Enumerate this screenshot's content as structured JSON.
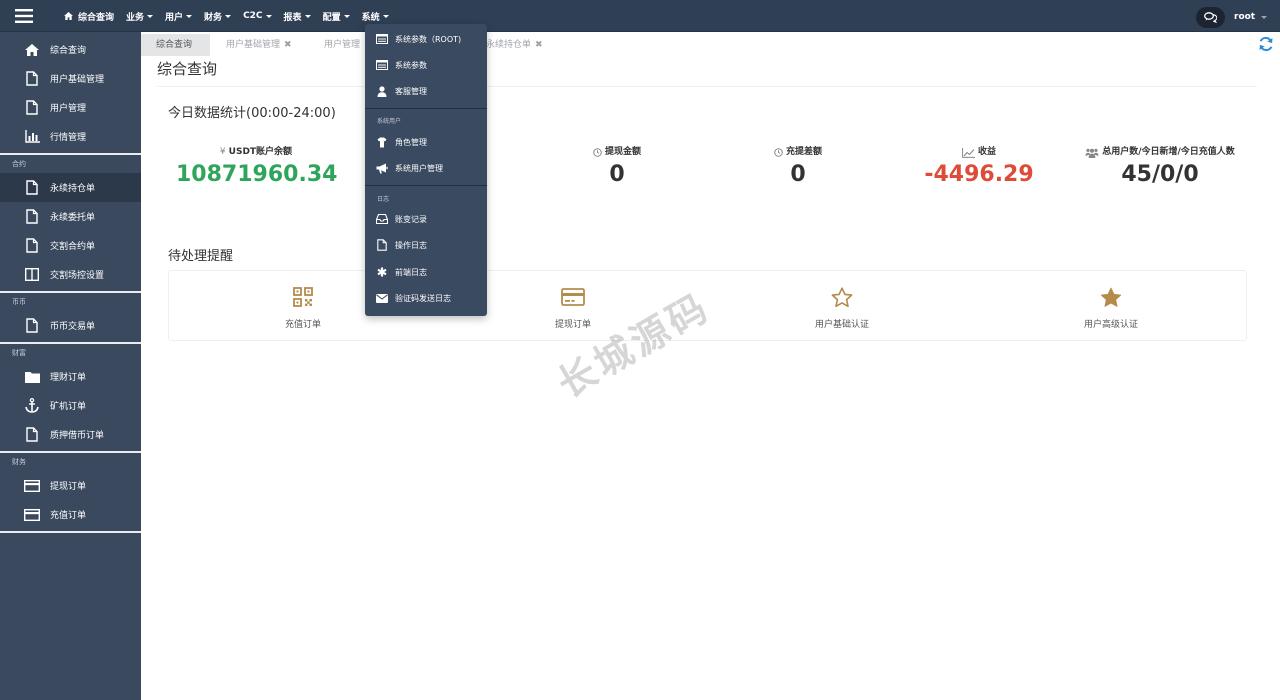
{
  "topbar": {
    "nav": [
      {
        "label": "综合查询",
        "icon": "home-icon",
        "has_caret": false
      },
      {
        "label": "业务",
        "has_caret": true
      },
      {
        "label": "用户",
        "has_caret": true
      },
      {
        "label": "财务",
        "has_caret": true
      },
      {
        "label": "C2C",
        "has_caret": true
      },
      {
        "label": "报表",
        "has_caret": true
      },
      {
        "label": "配置",
        "has_caret": true
      },
      {
        "label": "系统",
        "has_caret": true
      }
    ],
    "user": "root"
  },
  "sidebar": {
    "group0": {
      "items": [
        {
          "label": "综合查询",
          "icon": "home-icon"
        },
        {
          "label": "用户基础管理",
          "icon": "file-icon"
        },
        {
          "label": "用户管理",
          "icon": "file-icon"
        },
        {
          "label": "行情管理",
          "icon": "bar-chart-icon"
        }
      ]
    },
    "group1": {
      "title": "合约",
      "items": [
        {
          "label": "永续持仓单",
          "icon": "file-icon",
          "active": true
        },
        {
          "label": "永续委托单",
          "icon": "file-icon"
        },
        {
          "label": "交割合约单",
          "icon": "file-icon"
        },
        {
          "label": "交割场控设置",
          "icon": "columns-icon"
        }
      ]
    },
    "group2": {
      "title": "币币",
      "items": [
        {
          "label": "币币交易单",
          "icon": "file-icon"
        }
      ]
    },
    "group3": {
      "title": "财富",
      "items": [
        {
          "label": "理财订单",
          "icon": "folder-icon"
        },
        {
          "label": "矿机订单",
          "icon": "anchor-icon"
        },
        {
          "label": "质押借币订单",
          "icon": "file-icon"
        }
      ]
    },
    "group4": {
      "title": "财务",
      "items": [
        {
          "label": "提现订单",
          "icon": "credit-card-icon"
        },
        {
          "label": "充值订单",
          "icon": "credit-card-icon"
        }
      ]
    }
  },
  "tabs": [
    {
      "label": "综合查询",
      "active": true
    },
    {
      "label": "用户基础管理",
      "closable": true
    },
    {
      "label": "用户管理",
      "closable": false
    },
    {
      "label": "永续持仓单",
      "closable": true
    }
  ],
  "main": {
    "title": "综合查询",
    "stats_title": "今日数据统计(00:00-24:00)",
    "stats": [
      {
        "label": "USDT账户余额",
        "icon": "yen-icon",
        "value": "10871960.34",
        "color": "#2ea55a"
      },
      {
        "label": "提现金额",
        "icon": "clock-icon",
        "value": "0",
        "color": "#333333"
      },
      {
        "label": "充提差额",
        "icon": "clock-icon",
        "value": "0",
        "color": "#333333"
      },
      {
        "label": "收益",
        "icon": "line-chart-icon",
        "value": "-4496.29",
        "color": "#dd4b39"
      },
      {
        "label": "总用户数/今日新增/今日充值人数",
        "icon": "users-icon",
        "value": "45/0/0",
        "color": "#333333"
      }
    ],
    "pending_title": "待处理提醒",
    "pending": [
      {
        "label": "充值订单",
        "icon": "qrcode-icon"
      },
      {
        "label": "提现订单",
        "icon": "credit-card-icon"
      },
      {
        "label": "用户基础认证",
        "icon": "star-outline-icon"
      },
      {
        "label": "用户高级认证",
        "icon": "star-icon"
      }
    ]
  },
  "dropdown": {
    "group1": [
      {
        "label": "系统参数（ROOT)",
        "icon": "list-icon"
      },
      {
        "label": "系统参数",
        "icon": "list-icon"
      },
      {
        "label": "客服管理",
        "icon": "user-icon"
      }
    ],
    "header2": "系统用户",
    "group2": [
      {
        "label": "角色管理",
        "icon": "shirt-icon"
      },
      {
        "label": "系统用户管理",
        "icon": "bullhorn-icon"
      }
    ],
    "header3": "日志",
    "group3": [
      {
        "label": "账变记录",
        "icon": "inbox-icon"
      },
      {
        "label": "操作日志",
        "icon": "file-icon"
      },
      {
        "label": "前端日志",
        "icon": "asterisk-icon"
      },
      {
        "label": "验证码发送日志",
        "icon": "envelope-icon"
      }
    ]
  },
  "watermark": "长城源码",
  "colors": {
    "topbar": "#2f3f54",
    "sidebar": "#3a495e",
    "accent_gold": "#b58b4c",
    "positive": "#2ea55a",
    "negative": "#dd4b39"
  }
}
